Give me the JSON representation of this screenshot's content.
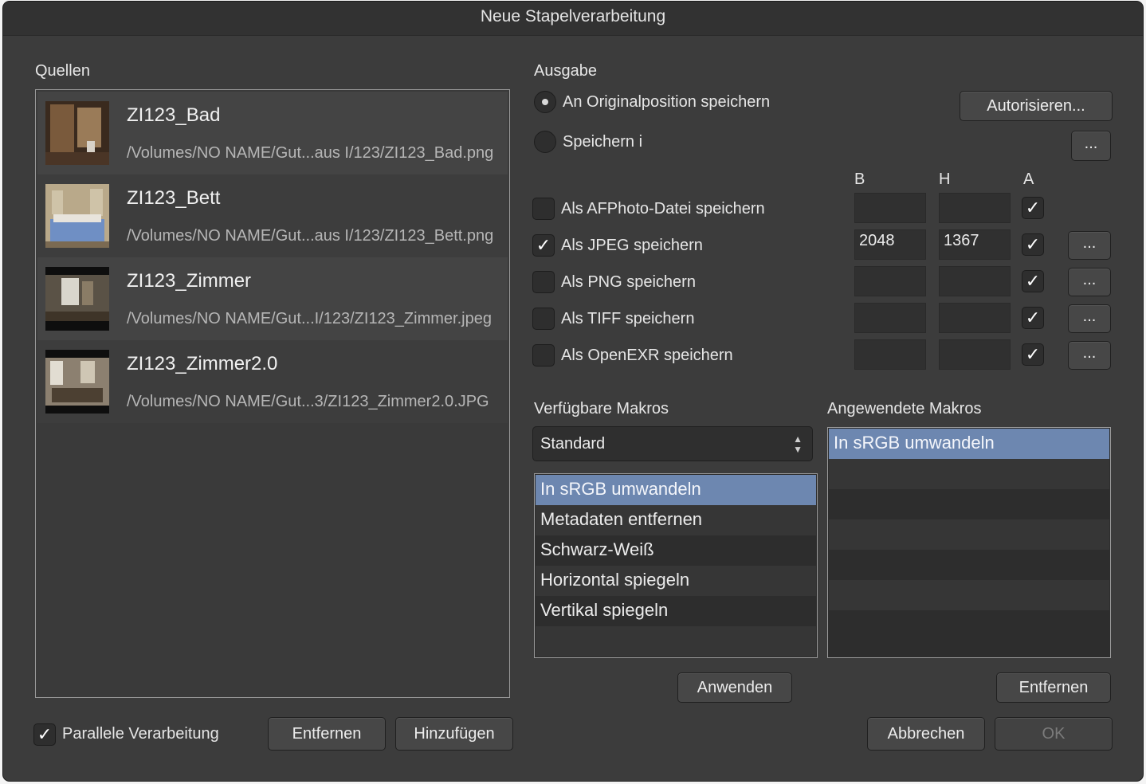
{
  "window": {
    "title": "Neue Stapelverarbeitung"
  },
  "sources": {
    "label": "Quellen",
    "items": [
      {
        "name": "ZI123_Bad",
        "path": "/Volumes/NO NAME/Gut...aus I/123/ZI123_Bad.png"
      },
      {
        "name": "ZI123_Bett",
        "path": "/Volumes/NO NAME/Gut...aus I/123/ZI123_Bett.png"
      },
      {
        "name": "ZI123_Zimmer",
        "path": "/Volumes/NO NAME/Gut...I/123/ZI123_Zimmer.jpeg"
      },
      {
        "name": "ZI123_Zimmer2.0",
        "path": "/Volumes/NO NAME/Gut...3/ZI123_Zimmer2.0.JPG"
      }
    ],
    "parallel_label": "Parallele Verarbeitung",
    "parallel_checked": true,
    "remove_label": "Entfernen",
    "add_label": "Hinzufügen"
  },
  "output": {
    "label": "Ausgabe",
    "radio_original": "An Originalposition speichern",
    "radio_save_in": "Speichern i",
    "selected_radio": "original",
    "authorize_label": "Autorisieren...",
    "browse_label": "...",
    "col_w": "B",
    "col_h": "H",
    "col_a": "A",
    "formats": [
      {
        "label": "Als AFPhoto-Datei speichern",
        "checked": false,
        "width": "",
        "height": "",
        "aspect": true,
        "has_options": false
      },
      {
        "label": "Als JPEG speichern",
        "checked": true,
        "width": "2048",
        "height": "1367",
        "aspect": true,
        "has_options": true
      },
      {
        "label": "Als PNG speichern",
        "checked": false,
        "width": "",
        "height": "",
        "aspect": true,
        "has_options": true
      },
      {
        "label": "Als TIFF speichern",
        "checked": false,
        "width": "",
        "height": "",
        "aspect": true,
        "has_options": true
      },
      {
        "label": "Als OpenEXR speichern",
        "checked": false,
        "width": "",
        "height": "",
        "aspect": true,
        "has_options": true
      }
    ],
    "options_label": "..."
  },
  "macros": {
    "available_label": "Verfügbare Makros",
    "applied_label": "Angewendete Makros",
    "category": "Standard",
    "available": [
      "In sRGB umwandeln",
      "Metadaten entfernen",
      "Schwarz-Weiß",
      "Horizontal spiegeln",
      "Vertikal spiegeln"
    ],
    "available_selected": 0,
    "applied": [
      "In sRGB umwandeln"
    ],
    "applied_selected": 0,
    "apply_label": "Anwenden",
    "remove_label": "Entfernen"
  },
  "footer": {
    "cancel_label": "Abbrechen",
    "ok_label": "OK",
    "ok_enabled": false
  },
  "colors": {
    "selection": "#6d87b0",
    "dialog_bg": "#3c3c3c"
  }
}
